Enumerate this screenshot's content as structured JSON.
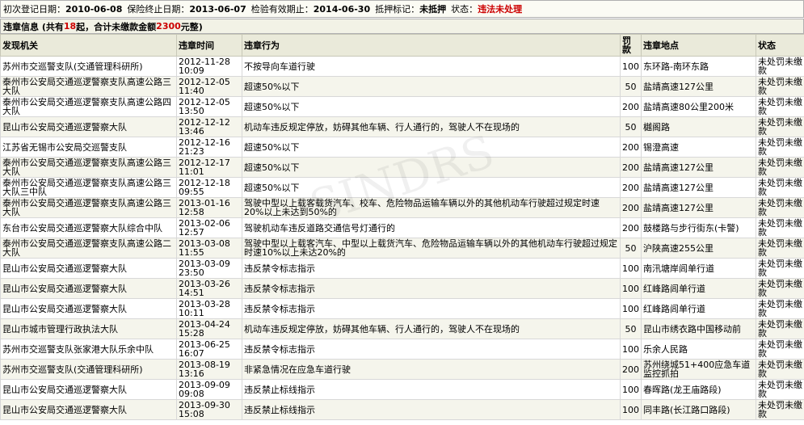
{
  "header": {
    "first_reg_label": "初次登记日期：",
    "first_reg_value": "2010-06-08",
    "insurance_end_label": "保险终止日期：",
    "insurance_end_value": "2013-06-07",
    "inspection_label": "检验有效期止：",
    "inspection_value": "2014-06-30",
    "mortgage_label": "抵押标记：",
    "mortgage_value": "未抵押",
    "status_label": "状态：",
    "status_value": "违法未处理"
  },
  "summary": {
    "prefix": "违章信息 (共有",
    "count": "18",
    "middle": "起，合计未缴款金额",
    "amount": "2300",
    "suffix": "元整)"
  },
  "columns": [
    "发现机关",
    "违章时间",
    "违章行为",
    "罚款",
    "违章地点",
    "状态"
  ],
  "rows": [
    {
      "agency": "苏州市交巡警支队(交通管理科研所)",
      "time": "2012-11-28 10:09",
      "act": "不按导向车道行驶",
      "fine": "100",
      "place": "东环路-南环东路",
      "status": "未处罚未缴款"
    },
    {
      "agency": "泰州市公安局交通巡逻警察支队高速公路三大队",
      "time": "2012-12-05 11:40",
      "act": "超速50%以下",
      "fine": "50",
      "place": "盐靖高速127公里",
      "status": "未处罚未缴款"
    },
    {
      "agency": "泰州市公安局交通巡逻警察支队高速公路四大队",
      "time": "2012-12-05 13:50",
      "act": "超速50%以下",
      "fine": "200",
      "place": "盐靖高速80公里200米",
      "status": "未处罚未缴款"
    },
    {
      "agency": "昆山市公安局交通巡逻警察大队",
      "time": "2012-12-12 13:46",
      "act": "机动车违反规定停放，妨碍其他车辆、行人通行的，驾驶人不在现场的",
      "fine": "50",
      "place": "樾阁路",
      "status": "未处罚未缴款"
    },
    {
      "agency": "江苏省无锡市公安局交巡警支队",
      "time": "2012-12-16 21:23",
      "act": "超速50%以下",
      "fine": "200",
      "place": "锡澄高速",
      "status": "未处罚未缴款"
    },
    {
      "agency": "泰州市公安局交通巡逻警察支队高速公路三大队",
      "time": "2012-12-17 11:01",
      "act": "超速50%以下",
      "fine": "200",
      "place": "盐靖高速127公里",
      "status": "未处罚未缴款"
    },
    {
      "agency": "泰州市公安局交通巡逻警察支队高速公路三大队三中队",
      "time": "2012-12-18 09:55",
      "act": "超速50%以下",
      "fine": "200",
      "place": "盐靖高速127公里",
      "status": "未处罚未缴款"
    },
    {
      "agency": "泰州市公安局交通巡逻警察支队高速公路三大队",
      "time": "2013-01-16 12:58",
      "act": "驾驶中型以上载客载货汽车、校车、危险物品运输车辆以外的其他机动车行驶超过规定时速20%以上未达到50%的",
      "fine": "200",
      "place": "盐靖高速127公里",
      "status": "未处罚未缴款"
    },
    {
      "agency": "东台市公安局交通巡逻警察大队综合中队",
      "time": "2013-02-06 12:57",
      "act": "驾驶机动车违反道路交通信号灯通行的",
      "fine": "200",
      "place": "鼓楼路与步行街东(卡警)",
      "status": "未处罚未缴款"
    },
    {
      "agency": "泰州市公安局交通巡逻警察支队高速公路二大队",
      "time": "2013-03-08 11:55",
      "act": "驾驶中型以上载客汽车、中型以上载货汽车、危险物品运输车辆以外的其他机动车行驶超过规定时速10%以上未达20%的",
      "fine": "50",
      "place": "沪陕高速255公里",
      "status": "未处罚未缴款"
    },
    {
      "agency": "昆山市公安局交通巡逻警察大队",
      "time": "2013-03-09 23:50",
      "act": "违反禁令标志指示",
      "fine": "100",
      "place": "南汛塘岸闾单行道",
      "status": "未处罚未缴款"
    },
    {
      "agency": "昆山市公安局交通巡逻警察大队",
      "time": "2013-03-26 14:51",
      "act": "违反禁令标志指示",
      "fine": "100",
      "place": "红峰路闾单行道",
      "status": "未处罚未缴款"
    },
    {
      "agency": "昆山市公安局交通巡逻警察大队",
      "time": "2013-03-28 10:11",
      "act": "违反禁令标志指示",
      "fine": "100",
      "place": "红峰路闾单行道",
      "status": "未处罚未缴款"
    },
    {
      "agency": "昆山市城市管理行政执法大队",
      "time": "2013-04-24 15:28",
      "act": "机动车违反规定停放，妨碍其他车辆、行人通行的，驾驶人不在现场的",
      "fine": "50",
      "place": "昆山市绣衣路中国移动前",
      "status": "未处罚未缴款"
    },
    {
      "agency": "苏州市交巡警支队张家港大队乐余中队",
      "time": "2013-06-25 16:07",
      "act": "违反禁令标志指示",
      "fine": "100",
      "place": "乐余人民路",
      "status": "未处罚未缴款"
    },
    {
      "agency": "苏州市交巡警支队(交通管理科研所)",
      "time": "2013-08-19 13:16",
      "act": "非紧急情况在应急车道行驶",
      "fine": "200",
      "place": "苏州绕城51+400应急车道监控抓拍",
      "status": "未处罚未缴款"
    },
    {
      "agency": "昆山市公安局交通巡逻警察大队",
      "time": "2013-09-09 09:08",
      "act": "违反禁止标线指示",
      "fine": "100",
      "place": "春晖路(龙王庙路段)",
      "status": "未处罚未缴款"
    },
    {
      "agency": "昆山市公安局交通巡逻警察大队",
      "time": "2013-09-30 15:08",
      "act": "违反禁止标线指示",
      "fine": "100",
      "place": "同丰路(长江路口路段)",
      "status": "未处罚未缴款"
    }
  ]
}
